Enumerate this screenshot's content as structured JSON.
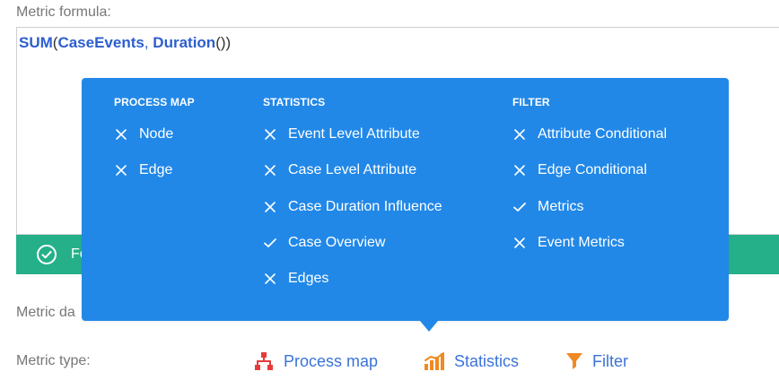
{
  "formula": {
    "label": "Metric formula:",
    "tokens": {
      "sum": "SUM",
      "open_paren_1": "(",
      "case_events": "CaseEvents",
      "comma": ", ",
      "duration": "Duration",
      "close_parens": "())"
    }
  },
  "status": {
    "text": "Fo",
    "icon": "check-circle-icon",
    "color": "#25b089"
  },
  "metric_data": {
    "label": "Metric da"
  },
  "metric_type": {
    "label": "Metric type:",
    "options": [
      {
        "label": "Process map",
        "icon": "process-map-icon",
        "icon_color": "#e63b3b"
      },
      {
        "label": "Statistics",
        "icon": "statistics-icon",
        "icon_color": "#f08a24"
      },
      {
        "label": "Filter",
        "icon": "filter-icon",
        "icon_color": "#f08a24"
      }
    ]
  },
  "popover": {
    "background": "#2188e8",
    "columns": [
      {
        "header": "PROCESS MAP",
        "items": [
          {
            "label": "Node",
            "state": "x"
          },
          {
            "label": "Edge",
            "state": "x"
          }
        ]
      },
      {
        "header": "STATISTICS",
        "items": [
          {
            "label": "Event Level Attribute",
            "state": "x"
          },
          {
            "label": "Case Level Attribute",
            "state": "x"
          },
          {
            "label": "Case Duration Influence",
            "state": "x"
          },
          {
            "label": "Case Overview",
            "state": "check"
          },
          {
            "label": "Edges",
            "state": "x"
          }
        ]
      },
      {
        "header": "FILTER",
        "items": [
          {
            "label": "Attribute Conditional",
            "state": "x"
          },
          {
            "label": "Edge Conditional",
            "state": "x"
          },
          {
            "label": "Metrics",
            "state": "check"
          },
          {
            "label": "Event Metrics",
            "state": "x"
          }
        ]
      }
    ]
  }
}
